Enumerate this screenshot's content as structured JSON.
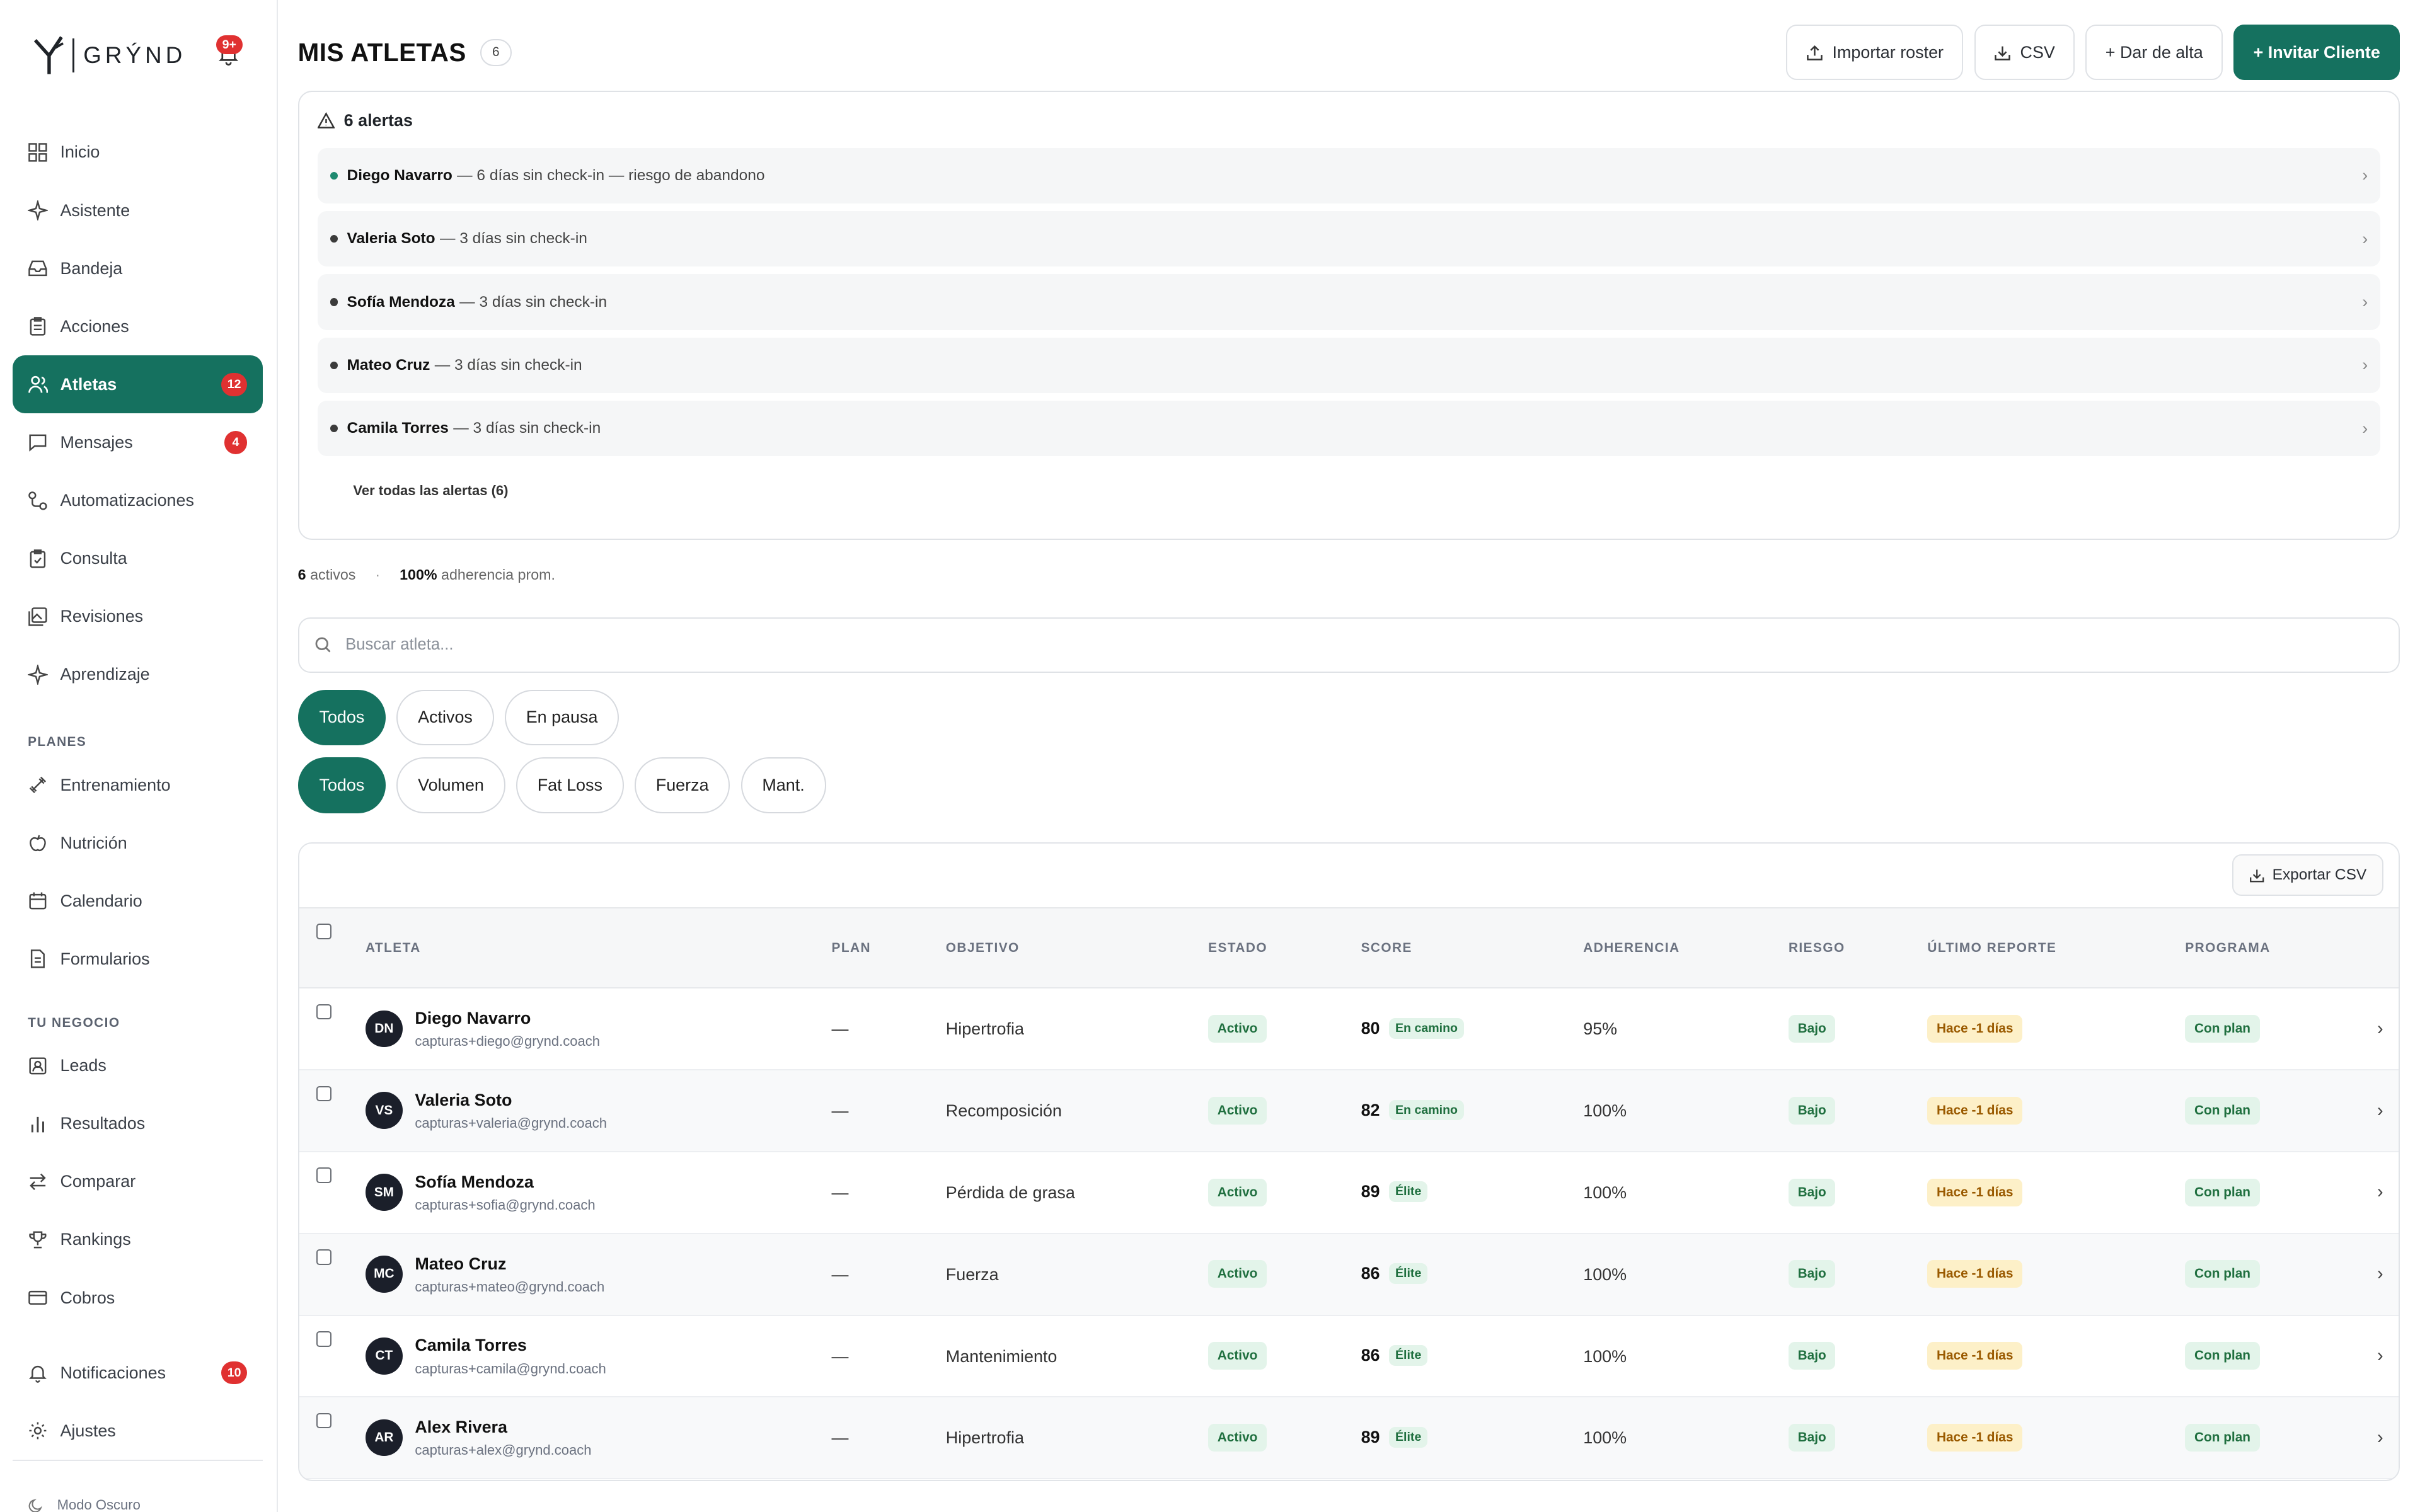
{
  "brand": {
    "name": "GRÝND",
    "bell_badge": "9+"
  },
  "nav": {
    "items": [
      {
        "label": "Inicio",
        "icon": "grid-icon"
      },
      {
        "label": "Asistente",
        "icon": "sparkle-icon"
      },
      {
        "label": "Bandeja",
        "icon": "inbox-icon"
      },
      {
        "label": "Acciones",
        "icon": "clipboard-icon"
      },
      {
        "label": "Atletas",
        "icon": "users-icon",
        "badge": "12",
        "active": true
      },
      {
        "label": "Mensajes",
        "icon": "message-icon",
        "badge": "4"
      },
      {
        "label": "Automatizaciones",
        "icon": "workflow-icon"
      },
      {
        "label": "Consulta",
        "icon": "clipboard-check-icon"
      },
      {
        "label": "Revisiones",
        "icon": "images-icon"
      },
      {
        "label": "Aprendizaje",
        "icon": "sparkle-icon"
      }
    ],
    "planes_title": "PLANES",
    "planes": [
      {
        "label": "Entrenamiento",
        "icon": "dumbbell-icon"
      },
      {
        "label": "Nutrición",
        "icon": "apple-icon"
      },
      {
        "label": "Calendario",
        "icon": "calendar-icon"
      },
      {
        "label": "Formularios",
        "icon": "form-icon"
      }
    ],
    "negocio_title": "TU NEGOCIO",
    "negocio": [
      {
        "label": "Leads",
        "icon": "contact-icon"
      },
      {
        "label": "Resultados",
        "icon": "bar-chart-icon"
      },
      {
        "label": "Comparar",
        "icon": "arrows-icon"
      },
      {
        "label": "Rankings",
        "icon": "trophy-icon"
      },
      {
        "label": "Cobros",
        "icon": "card-icon"
      }
    ],
    "bottom": [
      {
        "label": "Notificaciones",
        "icon": "bell-icon",
        "badge": "10"
      },
      {
        "label": "Ajustes",
        "icon": "gear-icon"
      }
    ],
    "dark_mode": "Modo Oscuro"
  },
  "header": {
    "title": "MIS ATLETAS",
    "count": "6",
    "buttons": {
      "import": "Importar roster",
      "csv": "CSV",
      "add": "+ Dar de alta",
      "invite": "+ Invitar Cliente"
    }
  },
  "alerts": {
    "title": "6 alertas",
    "items": [
      {
        "name": "Diego Navarro",
        "text": "— 6 días sin check-in — riesgo de abandono"
      },
      {
        "name": "Valeria Soto",
        "text": "— 3 días sin check-in"
      },
      {
        "name": "Sofía Mendoza",
        "text": "— 3 días sin check-in"
      },
      {
        "name": "Mateo Cruz",
        "text": "— 3 días sin check-in"
      },
      {
        "name": "Camila Torres",
        "text": "— 3 días sin check-in"
      }
    ],
    "see_all": "Ver todas las alertas (6)"
  },
  "stats": {
    "active_count": "6",
    "active_label": "activos",
    "adherence_value": "100%",
    "adherence_label": "adherencia prom."
  },
  "search": {
    "placeholder": "Buscar atleta..."
  },
  "filters": {
    "status": [
      "Todos",
      "Activos",
      "En pausa"
    ],
    "goal": [
      "Todos",
      "Volumen",
      "Fat Loss",
      "Fuerza",
      "Mant."
    ]
  },
  "table": {
    "export_label": "Exportar CSV",
    "columns": [
      "ATLETA",
      "PLAN",
      "OBJETIVO",
      "ESTADO",
      "SCORE",
      "ADHERENCIA",
      "RIESGO",
      "ÚLTIMO REPORTE",
      "PROGRAMA"
    ],
    "rows": [
      {
        "initials": "DN",
        "name": "Diego Navarro",
        "email": "capturas+diego@grynd.coach",
        "plan": "—",
        "goal": "Hipertrofia",
        "status": "Activo",
        "score": "80",
        "score_tag": "En camino",
        "adherence": "95%",
        "risk": "Bajo",
        "last_report": "Hace -1 días",
        "program": "Con plan"
      },
      {
        "initials": "VS",
        "name": "Valeria Soto",
        "email": "capturas+valeria@grynd.coach",
        "plan": "—",
        "goal": "Recomposición",
        "status": "Activo",
        "score": "82",
        "score_tag": "En camino",
        "adherence": "100%",
        "risk": "Bajo",
        "last_report": "Hace -1 días",
        "program": "Con plan"
      },
      {
        "initials": "SM",
        "name": "Sofía Mendoza",
        "email": "capturas+sofia@grynd.coach",
        "plan": "—",
        "goal": "Pérdida de grasa",
        "status": "Activo",
        "score": "89",
        "score_tag": "Élite",
        "adherence": "100%",
        "risk": "Bajo",
        "last_report": "Hace -1 días",
        "program": "Con plan"
      },
      {
        "initials": "MC",
        "name": "Mateo Cruz",
        "email": "capturas+mateo@grynd.coach",
        "plan": "—",
        "goal": "Fuerza",
        "status": "Activo",
        "score": "86",
        "score_tag": "Élite",
        "adherence": "100%",
        "risk": "Bajo",
        "last_report": "Hace -1 días",
        "program": "Con plan"
      },
      {
        "initials": "CT",
        "name": "Camila Torres",
        "email": "capturas+camila@grynd.coach",
        "plan": "—",
        "goal": "Mantenimiento",
        "status": "Activo",
        "score": "86",
        "score_tag": "Élite",
        "adherence": "100%",
        "risk": "Bajo",
        "last_report": "Hace -1 días",
        "program": "Con plan"
      },
      {
        "initials": "AR",
        "name": "Alex Rivera",
        "email": "capturas+alex@grynd.coach",
        "plan": "—",
        "goal": "Hipertrofia",
        "status": "Activo",
        "score": "89",
        "score_tag": "Élite",
        "adherence": "100%",
        "risk": "Bajo",
        "last_report": "Hace -1 días",
        "program": "Con plan"
      }
    ]
  }
}
